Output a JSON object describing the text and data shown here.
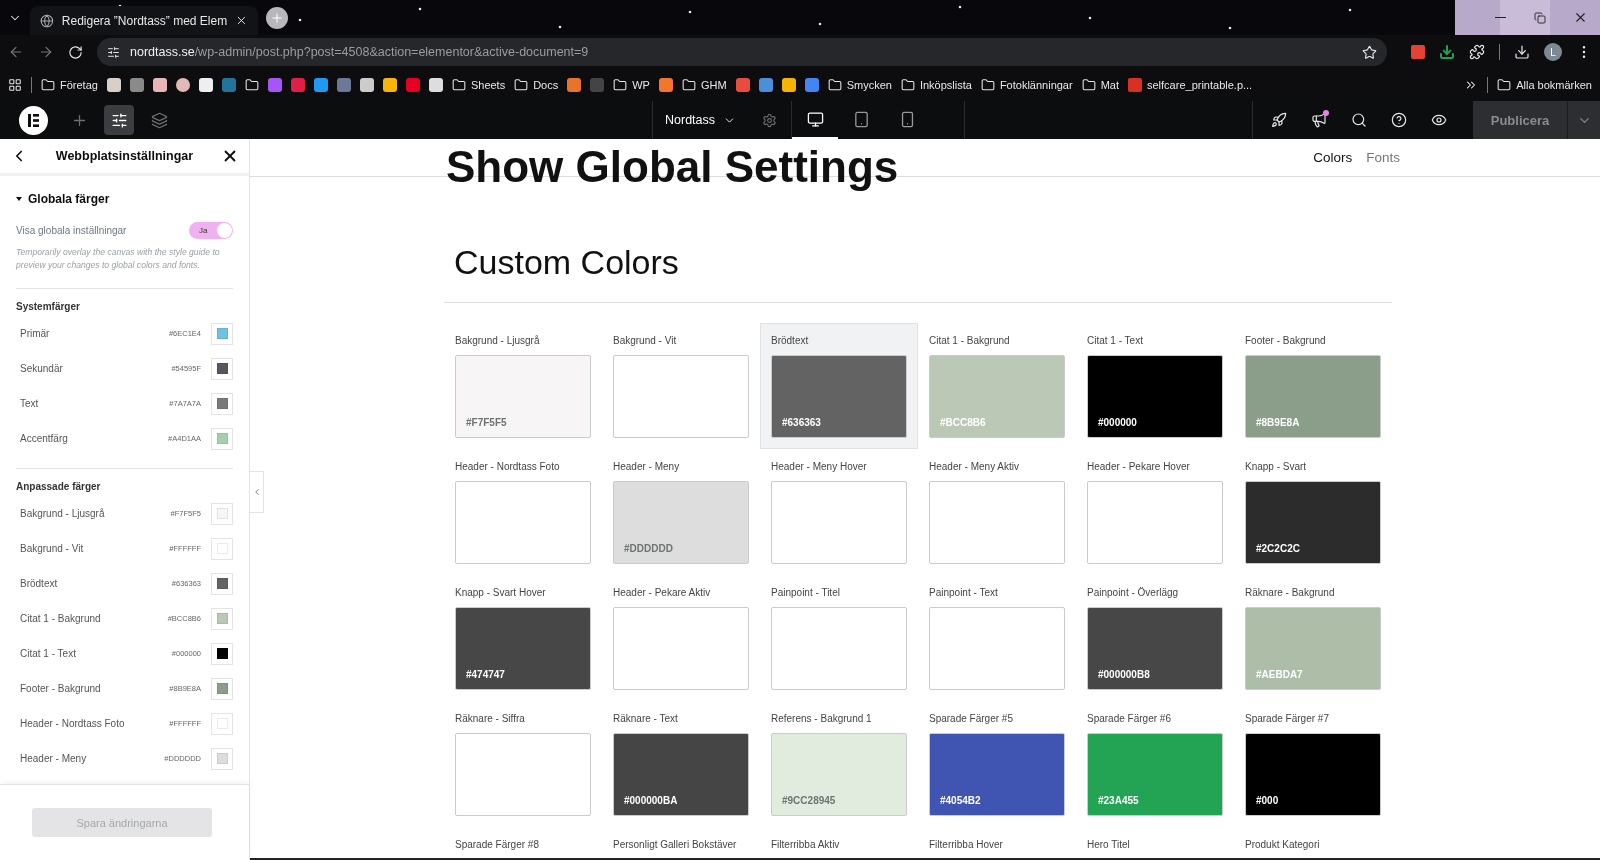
{
  "browser": {
    "tab": {
      "title": "Redigera ”Nordtass” med Elem"
    },
    "url": {
      "host": "nordtass.se",
      "path": "/wp-admin/post.php?post=4508&action=elementor&active-document=9"
    },
    "avatar": "L",
    "bookmarks": [
      {
        "kind": "folder",
        "label": "Företag"
      },
      {
        "kind": "site",
        "color": "#d8d0c8"
      },
      {
        "kind": "site",
        "color": "#8a8a8a"
      },
      {
        "kind": "site",
        "color": "#e8b4b8"
      },
      {
        "kind": "site",
        "color": "#e5b8b8"
      },
      {
        "kind": "site",
        "color": "#eeeeee"
      },
      {
        "kind": "site",
        "color": "#21759b"
      },
      {
        "kind": "folder"
      },
      {
        "kind": "site",
        "color": "#a855f7"
      },
      {
        "kind": "site",
        "color": "#e11d48"
      },
      {
        "kind": "site",
        "color": "#1d9bf0"
      },
      {
        "kind": "site",
        "color": "#6b7a99"
      },
      {
        "kind": "site",
        "color": "#cccccc"
      },
      {
        "kind": "site",
        "color": "#f5b50a"
      },
      {
        "kind": "site",
        "color": "#e60023"
      },
      {
        "kind": "site",
        "color": "#dddddd"
      },
      {
        "kind": "folder",
        "label": "Sheets"
      },
      {
        "kind": "folder",
        "label": "Docs"
      },
      {
        "kind": "site",
        "color": "#e8742a"
      },
      {
        "kind": "site",
        "color": "#444444"
      },
      {
        "kind": "folder",
        "label": "WP"
      },
      {
        "kind": "site",
        "color": "#f4762a"
      },
      {
        "kind": "folder",
        "label": "GHM"
      },
      {
        "kind": "site",
        "color": "#e74c3c"
      },
      {
        "kind": "site",
        "color": "#4a90d9"
      },
      {
        "kind": "site",
        "color": "#f4b400"
      },
      {
        "kind": "site",
        "color": "#4285f4"
      },
      {
        "kind": "folder",
        "label": "Smycken"
      },
      {
        "kind": "folder",
        "label": "Inköpslista"
      },
      {
        "kind": "folder",
        "label": "Fotoklänningar"
      },
      {
        "kind": "folder",
        "label": "Mat"
      },
      {
        "kind": "pdf",
        "label": "selfcare_printable.p..."
      }
    ],
    "all_bookmarks": "Alla bokmärken"
  },
  "editor": {
    "tools": [
      {
        "kind": "add",
        "selected": false
      },
      {
        "kind": "settings",
        "selected": true
      },
      {
        "kind": "layers",
        "selected": false
      }
    ],
    "site_name": "Nordtass",
    "devices": [
      {
        "kind": "desktop",
        "selected": true
      },
      {
        "kind": "tablet",
        "selected": false
      },
      {
        "kind": "mobile",
        "selected": false
      }
    ],
    "notification": true,
    "publish": {
      "label": "Publicera",
      "disabled": true
    }
  },
  "panel": {
    "title": "Webbplatsinställningar",
    "section": {
      "title": "Globala färger",
      "expanded": true
    },
    "toggle": {
      "label": "Visa globala inställningar",
      "value": "Ja",
      "on": true
    },
    "hint": "Temporarily overlay the canvas with the style guide to preview your changes to global colors and fonts.",
    "groups": [
      {
        "title": "Systemfärger",
        "colors": [
          {
            "name": "Primär",
            "hex": "#6EC1E4",
            "color": "#6ec1e4"
          },
          {
            "name": "Sekundär",
            "hex": "#54595F",
            "color": "#54595f"
          },
          {
            "name": "Text",
            "hex": "#7A7A7A",
            "color": "#7a7a7a"
          },
          {
            "name": "Accentfärg",
            "hex": "#A4D1AA",
            "color": "#a4d1aa"
          }
        ]
      },
      {
        "title": "Anpassade färger",
        "colors": [
          {
            "name": "Bakgrund - Ljusgrå",
            "hex": "#F7F5F5",
            "color": "#f7f5f5"
          },
          {
            "name": "Bakgrund - Vit",
            "hex": "#FFFFFF",
            "color": "#ffffff"
          },
          {
            "name": "Brödtext",
            "hex": "#636363",
            "color": "#636363"
          },
          {
            "name": "Citat 1 - Bakgrund",
            "hex": "#BCC8B6",
            "color": "#bcc8b6"
          },
          {
            "name": "Citat 1 - Text",
            "hex": "#000000",
            "color": "#000000"
          },
          {
            "name": "Footer - Bakgrund",
            "hex": "#8B9E8A",
            "color": "#8b9e8a"
          },
          {
            "name": "Header - Nordtass Foto",
            "hex": "#FFFFFF",
            "color": "#ffffff"
          },
          {
            "name": "Header - Meny",
            "hex": "#DDDDDD",
            "color": "#dddddd"
          }
        ]
      }
    ],
    "save": {
      "label": "Spara ändringarna",
      "disabled": true
    }
  },
  "canvas": {
    "title": "Show Global Settings",
    "tabs": [
      {
        "label": "Colors",
        "selected": true
      },
      {
        "label": "Fonts",
        "selected": false
      }
    ],
    "section_title": "Custom Colors",
    "swatches": [
      {
        "label": "Bakgrund - Ljusgrå",
        "color": "#f7f5f5",
        "hex": "#F7F5F5",
        "selected": false
      },
      {
        "label": "Bakgrund - Vit",
        "color": "#ffffff",
        "selected": false
      },
      {
        "label": "Brödtext",
        "color": "#636363",
        "hex": "#636363",
        "selected": true
      },
      {
        "label": "Citat 1 - Bakgrund",
        "color": "#bcc8b6",
        "hex": "#BCC8B6",
        "selected": false
      },
      {
        "label": "Citat 1 - Text",
        "color": "#000000",
        "hex": "#000000",
        "selected": false
      },
      {
        "label": "Footer - Bakgrund",
        "color": "#8b9e8a",
        "hex": "#8B9E8A",
        "selected": false
      },
      {
        "label": "Header - Nordtass Foto",
        "color": "#ffffff",
        "selected": false
      },
      {
        "label": "Header - Meny",
        "color": "#dddddd",
        "hex": "#DDDDDD",
        "selected": false
      },
      {
        "label": "Header - Meny Hover",
        "color": "#ffffff",
        "selected": false
      },
      {
        "label": "Header - Meny Aktiv",
        "color": "#ffffff",
        "selected": false
      },
      {
        "label": "Header - Pekare Hover",
        "color": "#ffffff",
        "selected": false
      },
      {
        "label": "Knapp - Svart",
        "color": "#2c2c2c",
        "hex": "#2C2C2C",
        "selected": false
      },
      {
        "label": "Knapp - Svart Hover",
        "color": "#474747",
        "hex": "#474747",
        "selected": false
      },
      {
        "label": "Header - Pekare Aktiv",
        "color": "#ffffff",
        "selected": false
      },
      {
        "label": "Painpoint - Titel",
        "color": "#ffffff",
        "selected": false
      },
      {
        "label": "Painpoint - Text",
        "color": "#ffffff",
        "selected": false
      },
      {
        "label": "Painpoint - Överlägg",
        "color": "#474747",
        "hex": "#000000B8",
        "selected": false
      },
      {
        "label": "Räknare - Bakgrund",
        "color": "#aebda7",
        "hex": "#AEBDA7",
        "selected": false
      },
      {
        "label": "Räknare - Siffra",
        "color": "#ffffff",
        "selected": false
      },
      {
        "label": "Räknare - Text",
        "color": "#454545",
        "hex": "#000000BA",
        "selected": false
      },
      {
        "label": "Referens - Bakgrund 1",
        "color": "#e1ecdf",
        "hex": "#9CC28945",
        "selected": false
      },
      {
        "label": "Sparade Färger #5",
        "color": "#4054b2",
        "hex": "#4054B2",
        "selected": false
      },
      {
        "label": "Sparade Färger #6",
        "color": "#23a455",
        "hex": "#23A455",
        "selected": false
      },
      {
        "label": "Sparade Färger #7",
        "color": "#000000",
        "hex": "#000",
        "selected": false
      },
      {
        "label": "Sparade Färger #8",
        "selected": false
      },
      {
        "label": "Personligt Galleri Bokstäver",
        "selected": false
      },
      {
        "label": "Filterribba Aktiv",
        "selected": false
      },
      {
        "label": "Filterribba Hover",
        "selected": false
      },
      {
        "label": "Hero Titel",
        "selected": false
      },
      {
        "label": "Produkt Kategori",
        "selected": false
      }
    ]
  }
}
